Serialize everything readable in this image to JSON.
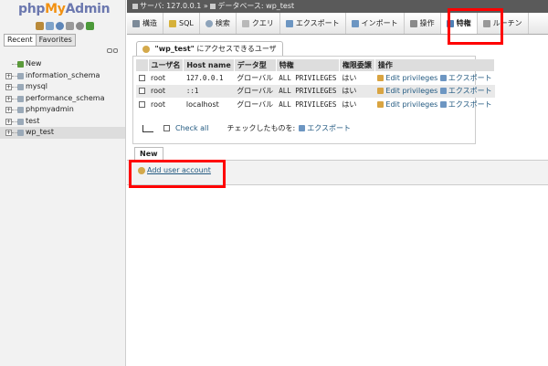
{
  "sidebar": {
    "logo": {
      "part1": "php",
      "part2": "My",
      "part3": "Admin"
    },
    "tabs": [
      {
        "label": "Recent"
      },
      {
        "label": "Favorites"
      }
    ],
    "databases": [
      {
        "label": "New"
      },
      {
        "label": "information_schema"
      },
      {
        "label": "mysql"
      },
      {
        "label": "performance_schema"
      },
      {
        "label": "phpmyadmin"
      },
      {
        "label": "test"
      },
      {
        "label": "wp_test"
      }
    ]
  },
  "breadcrumb": {
    "server_label": "サーバ: 127.0.0.1",
    "separator": "»",
    "database_label": "データベース: wp_test"
  },
  "menu": {
    "tabs": [
      {
        "label": "構造"
      },
      {
        "label": "SQL"
      },
      {
        "label": "検索"
      },
      {
        "label": "クエリ"
      },
      {
        "label": "エクスポート"
      },
      {
        "label": "インポート"
      },
      {
        "label": "操作"
      },
      {
        "label": "特権"
      },
      {
        "label": "ルーチン"
      }
    ]
  },
  "users_section": {
    "title_db": "\"wp_test\"",
    "title_suffix": "にアクセスできるユーザ",
    "columns": [
      "ユーザ名",
      "Host name",
      "データ型",
      "特権",
      "権限委譲",
      "操作"
    ],
    "rows": [
      {
        "user": "root",
        "host": "127.0.0.1",
        "type": "グローバル",
        "privileges": "ALL PRIVILEGES",
        "grant": "はい",
        "edit": "Edit privileges",
        "export": "エクスポート"
      },
      {
        "user": "root",
        "host": "::1",
        "type": "グローバル",
        "privileges": "ALL PRIVILEGES",
        "grant": "はい",
        "edit": "Edit privileges",
        "export": "エクスポート"
      },
      {
        "user": "root",
        "host": "localhost",
        "type": "グローバル",
        "privileges": "ALL PRIVILEGES",
        "grant": "はい",
        "edit": "Edit privileges",
        "export": "エクスポート"
      }
    ],
    "check_all": "Check all",
    "with_selected": "チェックしたものを:",
    "bulk_export": "エクスポート"
  },
  "new_section": {
    "legend": "New",
    "add_user": "Add user account"
  },
  "colors": {
    "annotation": "#ff0000",
    "link": "#235a81",
    "logo_blue": "#6c78af",
    "logo_orange": "#f29111"
  }
}
